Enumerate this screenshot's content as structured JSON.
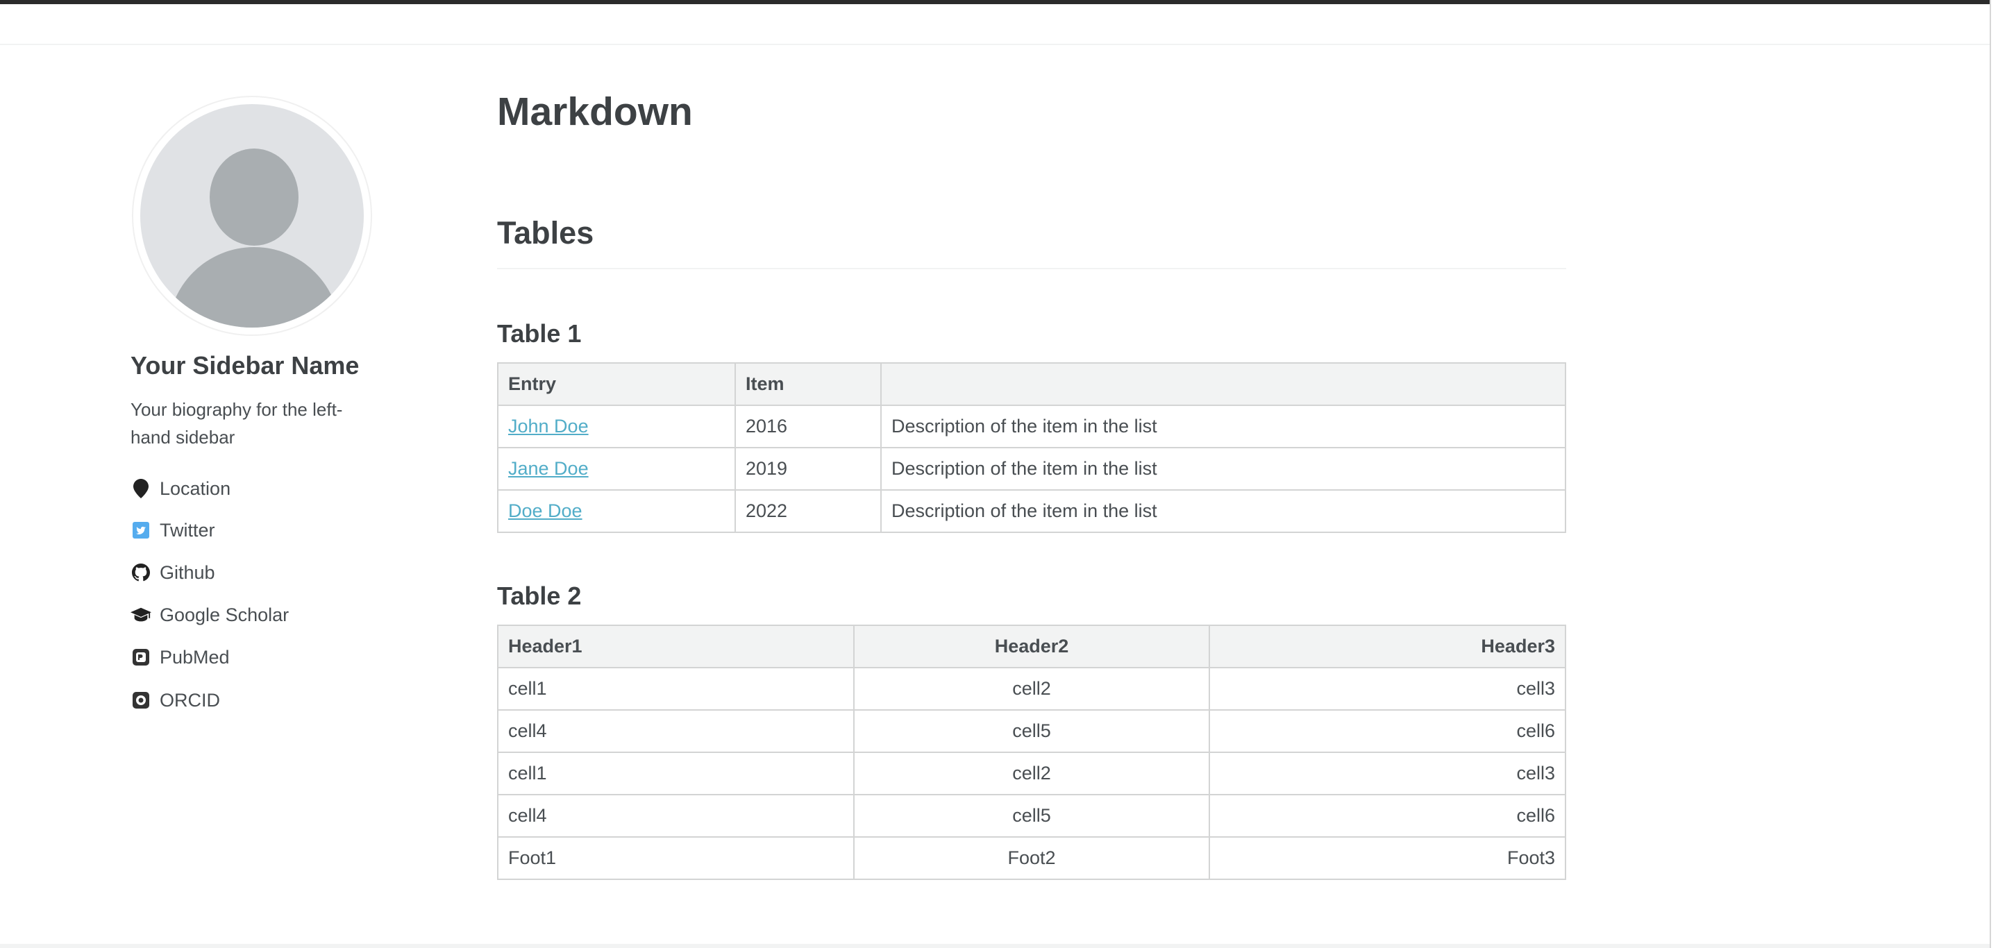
{
  "sidebar": {
    "name": "Your Sidebar Name",
    "bio": "Your biography for the left-hand sidebar",
    "links": [
      {
        "label": "Location",
        "icon": "map-marker-icon"
      },
      {
        "label": "Twitter",
        "icon": "twitter-icon",
        "color": "#55acee"
      },
      {
        "label": "Github",
        "icon": "github-icon"
      },
      {
        "label": "Google Scholar",
        "icon": "graduation-cap-icon"
      },
      {
        "label": "PubMed",
        "icon": "pubmed-icon"
      },
      {
        "label": "ORCID",
        "icon": "orcid-icon"
      }
    ]
  },
  "main": {
    "title": "Markdown",
    "section_title": "Tables",
    "table1": {
      "title": "Table 1",
      "headers": [
        "Entry",
        "Item",
        ""
      ],
      "rows": [
        {
          "entry": "John Doe",
          "item": "2016",
          "desc": "Description of the item in the list"
        },
        {
          "entry": "Jane Doe",
          "item": "2019",
          "desc": "Description of the item in the list"
        },
        {
          "entry": "Doe Doe",
          "item": "2022",
          "desc": "Description of the item in the list"
        }
      ]
    },
    "table2": {
      "title": "Table 2",
      "headers": [
        "Header1",
        "Header2",
        "Header3"
      ],
      "rows": [
        [
          "cell1",
          "cell2",
          "cell3"
        ],
        [
          "cell4",
          "cell5",
          "cell6"
        ],
        [
          "cell1",
          "cell2",
          "cell3"
        ],
        [
          "cell4",
          "cell5",
          "cell6"
        ]
      ],
      "footer": [
        "Foot1",
        "Foot2",
        "Foot3"
      ]
    }
  },
  "colors": {
    "link": "#52adc8",
    "heading": "#3d4144",
    "text": "#494e52",
    "table_header_bg": "#f2f3f3",
    "table_border": "#d3d4d4"
  }
}
